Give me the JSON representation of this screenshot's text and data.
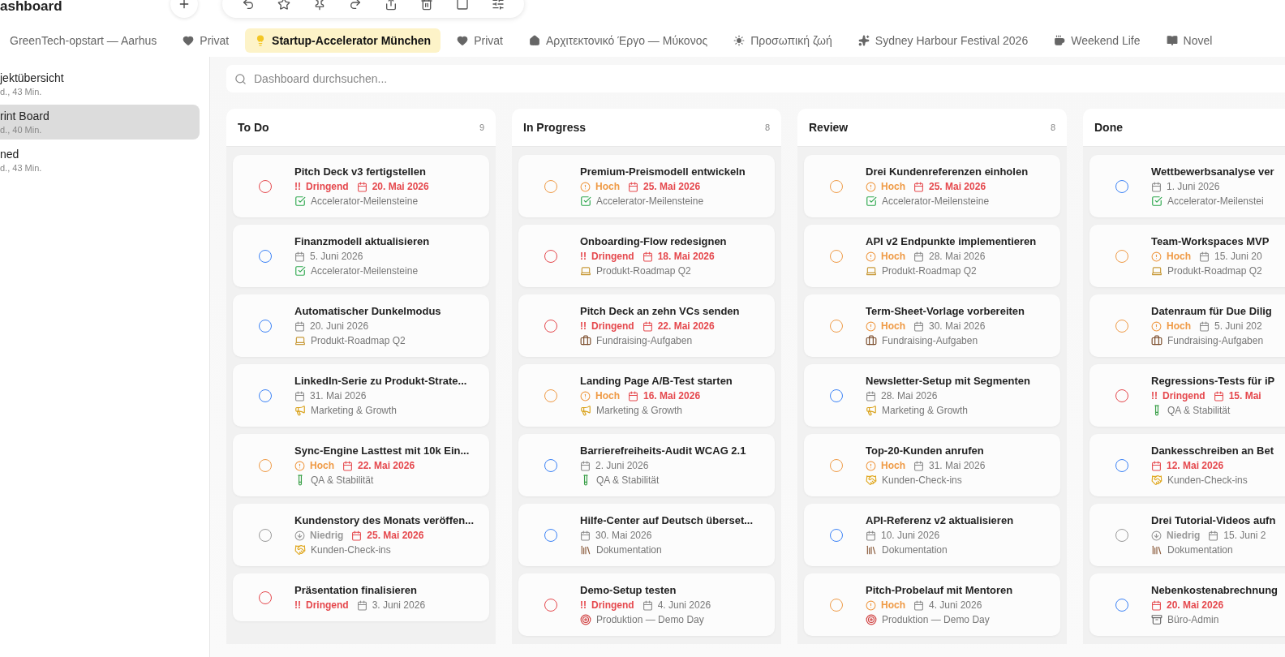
{
  "title": "ashboard",
  "tabs": [
    {
      "label": "GreenTech-opstart — Aarhus",
      "kind": "plain",
      "selected": false
    },
    {
      "label": "Privat",
      "kind": "heart",
      "selected": false
    },
    {
      "label": "Startup-Accelerator München",
      "kind": "bulb",
      "selected": true
    },
    {
      "label": "Privat",
      "kind": "heart",
      "selected": false
    },
    {
      "label": "Αρχιτεκτονικό Έργο — Μύκονος",
      "kind": "houses",
      "selected": false
    },
    {
      "label": "Προσωπική ζωή",
      "kind": "sun",
      "selected": false
    },
    {
      "label": "Sydney Harbour Festival 2026",
      "kind": "sparkle",
      "selected": false
    },
    {
      "label": "Weekend Life",
      "kind": "cup",
      "selected": false
    },
    {
      "label": "Novel",
      "kind": "book",
      "selected": false
    }
  ],
  "sidebar": {
    "items": [
      {
        "title": "jektübersicht",
        "subtitle": "d., 43 Min.",
        "selected": false
      },
      {
        "title": "rint Board",
        "subtitle": "d., 40 Min.",
        "selected": true
      },
      {
        "title": "ned",
        "subtitle": "d., 43 Min.",
        "selected": false
      }
    ]
  },
  "search": {
    "placeholder": "Dashboard durchsuchen..."
  },
  "columns": [
    {
      "title": "To Do",
      "count": "9",
      "cards": [
        {
          "title": "Pitch Deck v3 fertigstellen",
          "priority": {
            "kind": "urgent",
            "mark": "!!",
            "label": "Dringend"
          },
          "date": "20. Mai 2026",
          "overdue": true,
          "project": {
            "kind": "check",
            "name": "Accelerator-Meilensteine"
          }
        },
        {
          "title": "Finanzmodell aktualisieren",
          "priority": {
            "kind": "none"
          },
          "date": "5. Juni 2026",
          "overdue": false,
          "project": {
            "kind": "check",
            "name": "Accelerator-Meilensteine"
          }
        },
        {
          "title": "Automatischer Dunkelmodus",
          "priority": {
            "kind": "none"
          },
          "date": "20. Juni 2026",
          "overdue": false,
          "project": {
            "kind": "laptop",
            "name": "Produkt-Roadmap Q2"
          }
        },
        {
          "title": "LinkedIn-Serie zu Produkt-Strate...",
          "priority": {
            "kind": "none"
          },
          "date": "31. Mai 2026",
          "overdue": false,
          "project": {
            "kind": "megaphone",
            "name": "Marketing & Growth"
          }
        },
        {
          "title": "Sync-Engine Lasttest mit 10k Ein...",
          "priority": {
            "kind": "high",
            "label": "Hoch"
          },
          "date": "22. Mai 2026",
          "overdue": true,
          "project": {
            "kind": "tube",
            "name": "QA & Stabilität"
          }
        },
        {
          "title": "Kundenstory des Monats veröffen...",
          "priority": {
            "kind": "low",
            "label": "Niedrig"
          },
          "date": "25. Mai 2026",
          "overdue": true,
          "project": {
            "kind": "handshake",
            "name": "Kunden-Check-ins"
          }
        },
        {
          "title": "Präsentation finalisieren",
          "priority": {
            "kind": "urgent",
            "mark": "!!",
            "label": "Dringend"
          },
          "date": "3. Juni 2026",
          "overdue": false
        }
      ]
    },
    {
      "title": "In Progress",
      "count": "8",
      "cards": [
        {
          "title": "Premium-Preismodell entwickeln",
          "priority": {
            "kind": "high",
            "label": "Hoch"
          },
          "date": "25. Mai 2026",
          "overdue": true,
          "project": {
            "kind": "check",
            "name": "Accelerator-Meilensteine"
          }
        },
        {
          "title": "Onboarding-Flow redesignen",
          "priority": {
            "kind": "urgent",
            "mark": "!!",
            "label": "Dringend"
          },
          "date": "18. Mai 2026",
          "overdue": true,
          "project": {
            "kind": "laptop",
            "name": "Produkt-Roadmap Q2"
          }
        },
        {
          "title": "Pitch Deck an zehn VCs senden",
          "priority": {
            "kind": "urgent",
            "mark": "!!",
            "label": "Dringend"
          },
          "date": "22. Mai 2026",
          "overdue": true,
          "project": {
            "kind": "briefcase",
            "name": "Fundraising-Aufgaben"
          }
        },
        {
          "title": "Landing Page A/B-Test starten",
          "priority": {
            "kind": "high",
            "label": "Hoch"
          },
          "date": "16. Mai 2026",
          "overdue": true,
          "project": {
            "kind": "megaphone",
            "name": "Marketing & Growth"
          }
        },
        {
          "title": "Barrierefreiheits-Audit WCAG 2.1",
          "priority": {
            "kind": "none"
          },
          "date": "2. Juni 2026",
          "overdue": false,
          "project": {
            "kind": "tube",
            "name": "QA & Stabilität"
          }
        },
        {
          "title": "Hilfe-Center auf Deutsch überset...",
          "priority": {
            "kind": "none"
          },
          "date": "30. Mai 2026",
          "overdue": false,
          "project": {
            "kind": "books",
            "name": "Dokumentation"
          }
        },
        {
          "title": "Demo-Setup testen",
          "priority": {
            "kind": "urgent",
            "mark": "!!",
            "label": "Dringend"
          },
          "date": "4. Juni 2026",
          "overdue": false,
          "project": {
            "kind": "target",
            "name": "Produktion — Demo Day"
          }
        }
      ]
    },
    {
      "title": "Review",
      "count": "8",
      "cards": [
        {
          "title": "Drei Kundenreferenzen einholen",
          "priority": {
            "kind": "high",
            "label": "Hoch"
          },
          "date": "25. Mai 2026",
          "overdue": true,
          "project": {
            "kind": "check",
            "name": "Accelerator-Meilensteine"
          }
        },
        {
          "title": "API v2 Endpunkte implementieren",
          "priority": {
            "kind": "high",
            "label": "Hoch"
          },
          "date": "28. Mai 2026",
          "overdue": false,
          "project": {
            "kind": "laptop",
            "name": "Produkt-Roadmap Q2"
          }
        },
        {
          "title": "Term-Sheet-Vorlage vorbereiten",
          "priority": {
            "kind": "high",
            "label": "Hoch"
          },
          "date": "30. Mai 2026",
          "overdue": false,
          "project": {
            "kind": "briefcase",
            "name": "Fundraising-Aufgaben"
          }
        },
        {
          "title": "Newsletter-Setup mit Segmenten",
          "priority": {
            "kind": "none"
          },
          "date": "28. Mai 2026",
          "overdue": false,
          "project": {
            "kind": "megaphone",
            "name": "Marketing & Growth"
          }
        },
        {
          "title": "Top-20-Kunden anrufen",
          "priority": {
            "kind": "high",
            "label": "Hoch"
          },
          "date": "31. Mai 2026",
          "overdue": false,
          "project": {
            "kind": "handshake",
            "name": "Kunden-Check-ins"
          }
        },
        {
          "title": "API-Referenz v2 aktualisieren",
          "priority": {
            "kind": "none"
          },
          "date": "10. Juni 2026",
          "overdue": false,
          "project": {
            "kind": "books",
            "name": "Dokumentation"
          }
        },
        {
          "title": "Pitch-Probelauf mit Mentoren",
          "priority": {
            "kind": "high",
            "label": "Hoch"
          },
          "date": "4. Juni 2026",
          "overdue": false,
          "project": {
            "kind": "target",
            "name": "Produktion — Demo Day"
          }
        }
      ]
    },
    {
      "title": "Done",
      "cards": [
        {
          "title": "Wettbewerbsanalyse ver",
          "priority": {
            "kind": "none"
          },
          "date": "1. Juni 2026",
          "overdue": false,
          "project": {
            "kind": "check",
            "name": "Accelerator-Meilenstei"
          }
        },
        {
          "title": "Team-Workspaces MVP",
          "priority": {
            "kind": "high",
            "label": "Hoch"
          },
          "date": "15. Juni 20",
          "overdue": false,
          "project": {
            "kind": "laptop",
            "name": "Produkt-Roadmap Q2"
          }
        },
        {
          "title": "Datenraum für Due Dilig",
          "priority": {
            "kind": "high",
            "label": "Hoch"
          },
          "date": "5. Juni 202",
          "overdue": false,
          "project": {
            "kind": "briefcase",
            "name": "Fundraising-Aufgaben"
          }
        },
        {
          "title": "Regressions-Tests für iP",
          "priority": {
            "kind": "urgent",
            "mark": "!!",
            "label": "Dringend"
          },
          "date": "15. Mai",
          "overdue": true,
          "project": {
            "kind": "tube",
            "name": "QA & Stabilität"
          }
        },
        {
          "title": "Dankesschreiben an Bet",
          "priority": {
            "kind": "none"
          },
          "date": "12. Mai 2026",
          "overdue": true,
          "project": {
            "kind": "handshake",
            "name": "Kunden-Check-ins"
          }
        },
        {
          "title": "Drei Tutorial-Videos aufn",
          "priority": {
            "kind": "low",
            "label": "Niedrig"
          },
          "date": "15. Juni 2",
          "overdue": false,
          "project": {
            "kind": "books",
            "name": "Dokumentation"
          }
        },
        {
          "title": "Nebenkostenabrechnung",
          "priority": {
            "kind": "none"
          },
          "date": "20. Mai 2026",
          "overdue": true,
          "project": {
            "kind": "cabinet",
            "name": "Büro-Admin"
          }
        }
      ]
    }
  ]
}
